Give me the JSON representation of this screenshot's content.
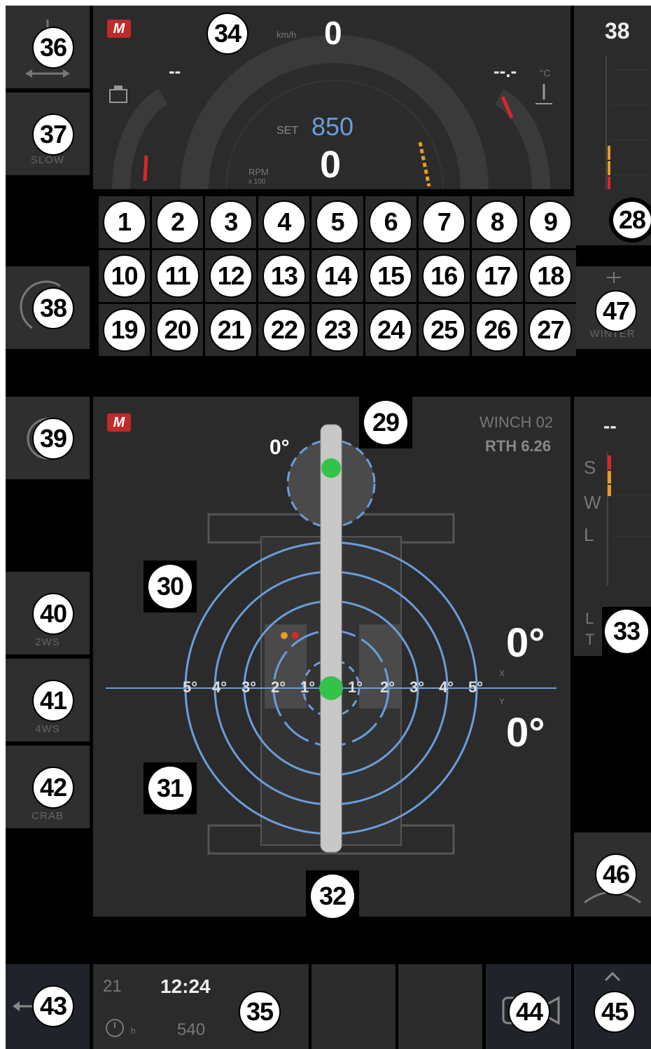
{
  "dashboard": {
    "speed_unit": "km/h",
    "speed_value": "0",
    "set_label": "SET",
    "set_rpm": "850",
    "rpm_value": "0",
    "rpm_label": "RPM",
    "rpm_unit": "x 100",
    "left_readout": "--",
    "temp_readout": "--.-",
    "temp_unit": "°C"
  },
  "right_gauge": {
    "value": "38"
  },
  "winch": {
    "title": "WINCH 02",
    "model": "RTH 6.26",
    "boom_angle": "0°"
  },
  "level": {
    "x_angle": "0°",
    "y_angle": "0°",
    "x_label": "X",
    "y_label": "Y",
    "scale_left": [
      "5°",
      "4°",
      "3°",
      "2°",
      "1°"
    ],
    "scale_right": [
      "1°",
      "2°",
      "3°",
      "4°",
      "5°"
    ]
  },
  "load_gauge": {
    "value": "--",
    "letters": [
      "S",
      "W",
      "L"
    ],
    "lt": [
      "L",
      "T"
    ]
  },
  "buttons": {
    "slow": "SLOW",
    "winter": "WINTER",
    "2ws": "2WS",
    "4ws": "4WS",
    "crab": "CRAB"
  },
  "status": {
    "day": "21",
    "time": "12:24",
    "hours": "540",
    "hours_unit": "h"
  },
  "callouts": {
    "grid": [
      "1",
      "2",
      "3",
      "4",
      "5",
      "6",
      "7",
      "8",
      "9",
      "10",
      "11",
      "12",
      "13",
      "14",
      "15",
      "16",
      "17",
      "18",
      "19",
      "20",
      "21",
      "22",
      "23",
      "24",
      "25",
      "26",
      "27"
    ],
    "c28": "28",
    "c29": "29",
    "c30": "30",
    "c31": "31",
    "c32": "32",
    "c33": "33",
    "c34": "34",
    "c35": "35",
    "c36": "36",
    "c37": "37",
    "c38a": "38",
    "c39": "39",
    "c40": "40",
    "c41": "41",
    "c42": "42",
    "c43": "43",
    "c44": "44",
    "c45": "45",
    "c46": "46",
    "c47": "47"
  },
  "colors": {
    "accent_blue": "#6b9ddb",
    "gauge_red": "#d8282a",
    "gauge_orange": "#e89a2a",
    "boom_green": "#33c24a",
    "brand_red": "#c02a2a"
  }
}
